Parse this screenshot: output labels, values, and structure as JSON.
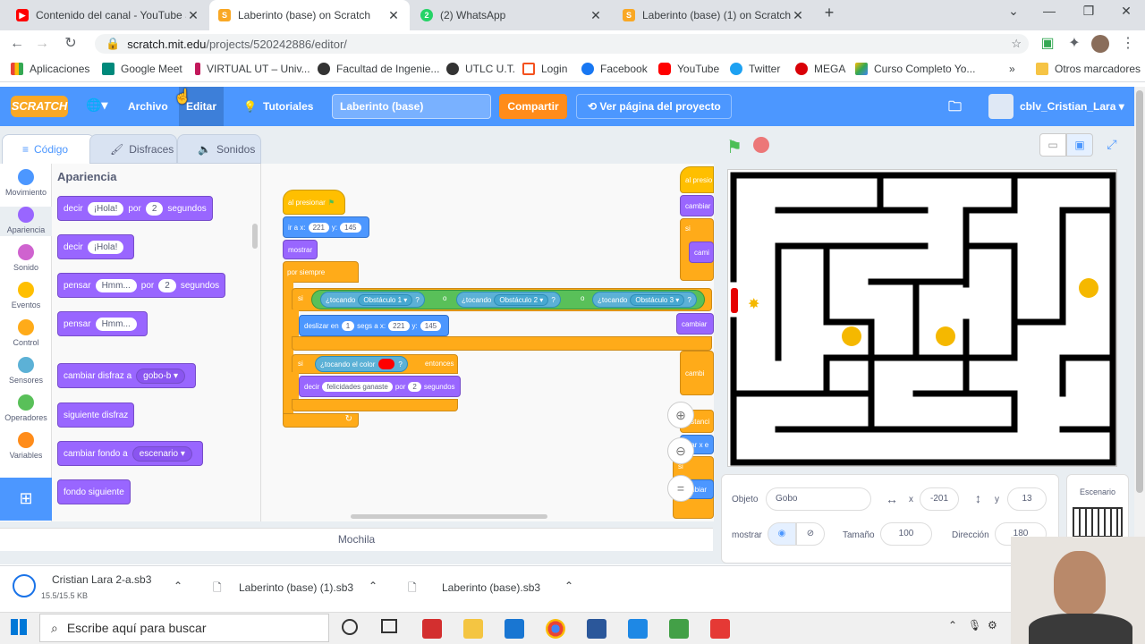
{
  "browser": {
    "tabs": [
      {
        "label": "Contenido del canal - YouTube S",
        "active": false,
        "icon_color": "#ff0000"
      },
      {
        "label": "Laberinto (base) on Scratch",
        "active": true,
        "icon_color": "#f9a825"
      },
      {
        "label": "(2) WhatsApp",
        "active": false,
        "icon_color": "#25d366"
      },
      {
        "label": "Laberinto (base) (1) on Scratch",
        "active": false,
        "icon_color": "#f9a825"
      }
    ],
    "url_host": "scratch.mit.edu",
    "url_path": "/projects/520242886/editor/",
    "bookmarks": [
      "Aplicaciones",
      "Google Meet",
      "VIRTUAL UT – Univ...",
      "Facultad de Ingenie...",
      "UTLC U.T.",
      "Login",
      "Facebook",
      "YouTube",
      "Twitter",
      "MEGA",
      "Curso Completo Yo...",
      "Otros marcadores"
    ]
  },
  "scratch": {
    "logo": "SCRATCH",
    "menu": {
      "archivo": "Archivo",
      "editar": "Editar",
      "tutoriales": "Tutoriales",
      "compartir": "Compartir",
      "ver_pagina": "Ver página del proyecto",
      "user": "cblv_Cristian_Lara"
    },
    "project_title": "Laberinto (base)",
    "editor_tabs": {
      "codigo": "Código",
      "disfraces": "Disfraces",
      "sonidos": "Sonidos"
    },
    "categories": [
      {
        "label": "Movimiento",
        "color": "#4c97ff"
      },
      {
        "label": "Apariencia",
        "color": "#9966ff"
      },
      {
        "label": "Sonido",
        "color": "#cf63cf"
      },
      {
        "label": "Eventos",
        "color": "#ffbf00"
      },
      {
        "label": "Control",
        "color": "#ffab19"
      },
      {
        "label": "Sensores",
        "color": "#5cb1d6"
      },
      {
        "label": "Operadores",
        "color": "#59c059"
      },
      {
        "label": "Variables",
        "color": "#ff8c1a"
      }
    ],
    "palette_heading": "Apariencia",
    "palette_blocks": {
      "b1": {
        "decir": "decir",
        "msg": "¡Hola!",
        "por": "por",
        "n": "2",
        "seg": "segundos"
      },
      "b2": {
        "decir": "decir",
        "msg": "¡Hola!"
      },
      "b3": {
        "pensar": "pensar",
        "msg": "Hmm...",
        "por": "por",
        "n": "2",
        "seg": "segundos"
      },
      "b4": {
        "pensar": "pensar",
        "msg": "Hmm..."
      },
      "b5": {
        "label": "cambiar disfraz a",
        "val": "gobo-b"
      },
      "b6": {
        "label": "siguiente disfraz"
      },
      "b7": {
        "label": "cambiar fondo a",
        "val": "escenario"
      },
      "b8": {
        "label": "fondo siguiente"
      }
    },
    "script": {
      "hat": "al presionar",
      "goto": {
        "label": "ir a x:",
        "x": "221",
        "ylab": "y:",
        "y": "145"
      },
      "show": "mostrar",
      "forever": "por siempre",
      "if1": "si",
      "touch1": "¿tocando",
      "obs1": "Obstáculo 1",
      "q": "?",
      "or": "o",
      "obs2": "Obstáculo 2",
      "obs3": "Obstáculo 3",
      "glide": {
        "label": "deslizar en",
        "n": "1",
        "segs": "segs a x:",
        "x": "221",
        "ylab": "y:",
        "y": "145"
      },
      "if2": "si",
      "touchcolor": "¿tocando el color",
      "entonces": "entonces",
      "say": {
        "label": "decir",
        "msg": "felicidades ganaste",
        "por": "por",
        "n": "2",
        "seg": "segundos"
      },
      "right_blocks": [
        "al presio",
        "cambiar",
        "si",
        "cami",
        "cambiar",
        "cambi",
        "distanci",
        "biar x e",
        "si",
        "mbiar"
      ]
    },
    "mochila": "Mochila",
    "sprite_info": {
      "objeto_label": "Objeto",
      "objeto": "Gobo",
      "x_label": "x",
      "x": "-201",
      "y_label": "y",
      "y": "13",
      "mostrar_label": "mostrar",
      "tamano_label": "Tamaño",
      "tamano": "100",
      "direccion_label": "Dirección",
      "direccion": "180"
    },
    "stage_panel": "Escenario"
  },
  "downloads": [
    {
      "name": "Cristian Lara 2-a.sb3",
      "size": "15.5/15.5 KB"
    },
    {
      "name": "Laberinto (base) (1).sb3"
    },
    {
      "name": "Laberinto (base).sb3"
    }
  ],
  "taskbar": {
    "search": "Escribe aquí para buscar"
  }
}
